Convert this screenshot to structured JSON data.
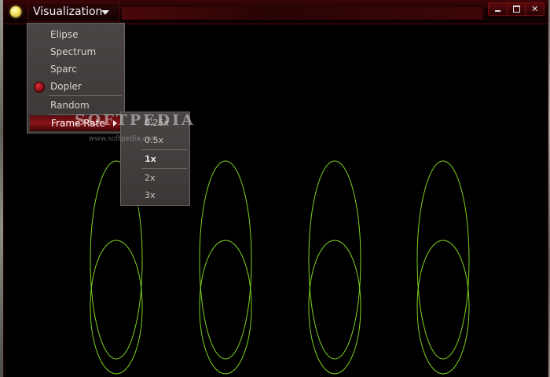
{
  "window": {
    "menu_button_label": "Visualization",
    "icons": {
      "app": "app-orb-icon",
      "dropdown": "chevron-down-icon",
      "minimize": "minimize-icon",
      "maximize": "maximize-icon",
      "close": "close-icon"
    }
  },
  "menu": {
    "items": [
      {
        "label": "Elipse",
        "selected": false
      },
      {
        "label": "Spectrum",
        "selected": false
      },
      {
        "label": "Sparc",
        "selected": false
      },
      {
        "label": "Dopler",
        "selected": true
      },
      {
        "label": "Random",
        "selected": false
      },
      {
        "label": "Frame Rate",
        "has_submenu": true,
        "highlighted": true
      }
    ]
  },
  "submenu": {
    "items": [
      {
        "label": "0.25x"
      },
      {
        "label": "0.5x"
      },
      {
        "label": "1x",
        "selected": true
      },
      {
        "label": "2x"
      },
      {
        "label": "3x"
      }
    ]
  },
  "watermark": {
    "brand": "SOFTPEDIA",
    "url": "www.softpedia.com"
  },
  "visualization": {
    "stroke_color": "#7ed321",
    "ellipse_groups": 4
  },
  "colors": {
    "accent": "#8a1418",
    "menu_bg": "#433e3d",
    "viz_line": "#7ed321"
  }
}
